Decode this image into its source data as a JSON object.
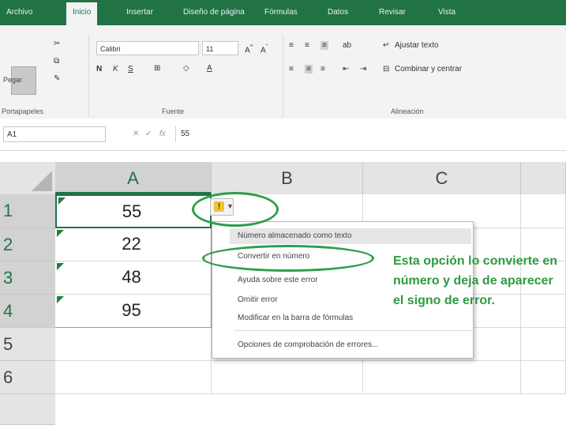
{
  "tabs": [
    "Archivo",
    "Inicio",
    "Insertar",
    "Diseño de página",
    "Fórmulas",
    "Datos",
    "Revisar",
    "Vista"
  ],
  "active_tab": "Inicio",
  "ribbon": {
    "paste_label": "Pegar",
    "font_name": "Calibri",
    "font_size": "11",
    "bold": "N",
    "italic": "K",
    "underline": "S",
    "wrap_text": "Ajustar texto",
    "merge_center": "Combinar y centrar",
    "groups": {
      "clipboard": "Portapapeles",
      "font": "Fuente",
      "alignment": "Alineación"
    }
  },
  "formula_bar": {
    "name_box": "A1",
    "fx": "fx",
    "content": "55"
  },
  "grid": {
    "columns": [
      "A",
      "B",
      "C"
    ],
    "rows": [
      "1",
      "2",
      "3",
      "4",
      "5",
      "6"
    ],
    "colA_values": [
      "55",
      "22",
      "48",
      "95"
    ]
  },
  "context_menu": {
    "title": "Número almacenado como texto",
    "items": [
      "Convertir en número",
      "Ayuda sobre este error",
      "Omitir error",
      "Modificar en la barra de fórmulas",
      "Opciones de comprobación de errores..."
    ]
  },
  "annotation": {
    "text": "Esta opción lo convierte en número y deja de aparecer el signo de error."
  },
  "colors": {
    "accent": "#217346",
    "annotation": "#2e9a42",
    "warning": "#f1c232"
  }
}
